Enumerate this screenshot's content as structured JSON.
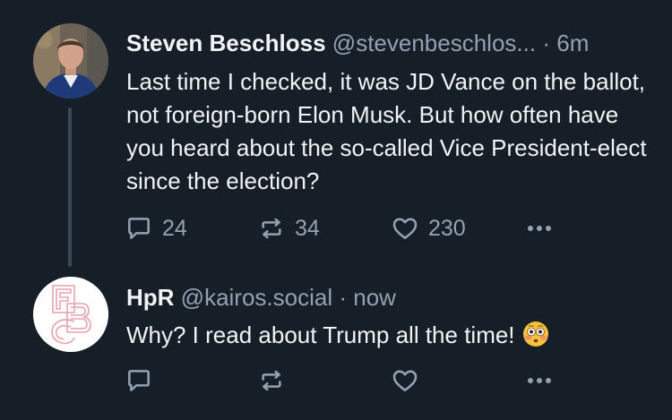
{
  "thread": {
    "posts": [
      {
        "author": {
          "display_name": "Steven Beschloss",
          "handle": "@stevenbeschlos..."
        },
        "separator": "·",
        "timestamp": "6m",
        "text": "Last time I checked, it was JD Vance on the ballot, not foreign-born Elon Musk. But how often have you heard about the so-called Vice President-elect since the election?",
        "counts": {
          "replies": "24",
          "reposts": "34",
          "likes": "230"
        }
      },
      {
        "author": {
          "display_name": "HpR",
          "handle": "@kairos.social"
        },
        "separator": "·",
        "timestamp": "now",
        "text": "Why? I read about Trump all the time!",
        "emoji": "flushed-face-emoji",
        "counts": {
          "replies": "",
          "reposts": "",
          "likes": ""
        }
      }
    ]
  },
  "icons": {
    "reply": "speech-bubble-icon",
    "repost": "repost-arrows-icon",
    "like": "heart-icon",
    "more": "ellipsis-icon"
  },
  "colors": {
    "background": "#161e27",
    "text_primary": "#f1f3f5",
    "text_secondary": "#93a1b2",
    "thread_line": "#3a4756"
  }
}
